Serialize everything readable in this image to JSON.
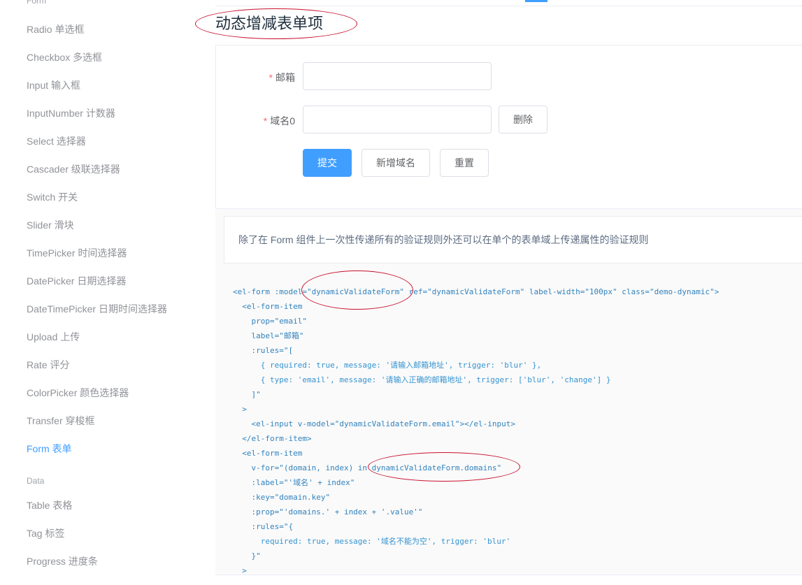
{
  "sidebar": {
    "top_group": "Form",
    "items": [
      "Radio 单选框",
      "Checkbox 多选框",
      "Input 输入框",
      "InputNumber 计数器",
      "Select 选择器",
      "Cascader 级联选择器",
      "Switch 开关",
      "Slider 滑块",
      "TimePicker 时间选择器",
      "DatePicker 日期选择器",
      "DateTimePicker 日期时间选择器",
      "Upload 上传",
      "Rate 评分",
      "ColorPicker 颜色选择器",
      "Transfer 穿梭框",
      "Form 表单"
    ],
    "active_item": "Form 表单",
    "data_group": "Data",
    "data_items": [
      "Table 表格",
      "Tag 标签",
      "Progress 进度条"
    ]
  },
  "page": {
    "title": "动态增减表单项"
  },
  "form": {
    "required_mark": "*",
    "email_label": "邮箱",
    "email_value": "",
    "domain_label": "域名0",
    "domain_value": "",
    "delete_label": "删除",
    "submit_label": "提交",
    "add_domain_label": "新增域名",
    "reset_label": "重置"
  },
  "description": "除了在 Form 组件上一次性传递所有的验证规则外还可以在单个的表单域上传递属性的验证规则",
  "code_lines": [
    "<el-form :model=\"dynamicValidateForm\" ref=\"dynamicValidateForm\" label-width=\"100px\" class=\"demo-dynamic\">",
    "  <el-form-item",
    "    prop=\"email\"",
    "    label=\"邮箱\"",
    "    :rules=\"[",
    "      { required: true, message: '请输入邮箱地址', trigger: 'blur' },",
    "      { type: 'email', message: '请输入正确的邮箱地址', trigger: ['blur', 'change'] }",
    "    ]\"",
    "  >",
    "    <el-input v-model=\"dynamicValidateForm.email\"></el-input>",
    "  </el-form-item>",
    "  <el-form-item",
    "    v-for=\"(domain, index) in dynamicValidateForm.domains\"",
    "    :label=\"'域名' + index\"",
    "    :key=\"domain.key\"",
    "    :prop=\"'domains.' + index + '.value'\"",
    "    :rules=\"{",
    "      required: true, message: '域名不能为空', trigger: 'blur'",
    "    }\"",
    "  >"
  ],
  "colors": {
    "accent": "#409eff",
    "annotation": "#c8102e",
    "required": "#f56c6c"
  }
}
